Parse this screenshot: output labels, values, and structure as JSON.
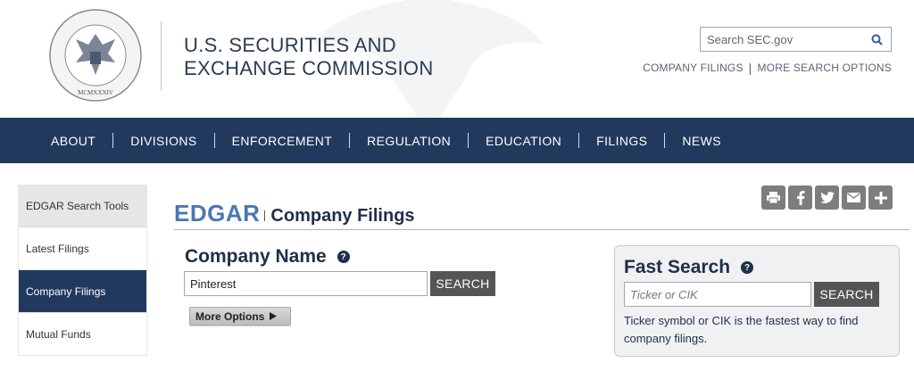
{
  "header": {
    "agency_line1": "U.S. SECURITIES AND",
    "agency_line2": "EXCHANGE COMMISSION",
    "seal_text": "U.S. SECURITIES AND EXCHANGE COMMISSION",
    "seal_year": "MCMXXXIV",
    "search_placeholder": "Search SEC.gov",
    "link_company_filings": "COMPANY FILINGS",
    "link_more_search": "MORE SEARCH OPTIONS"
  },
  "nav": {
    "items": [
      "ABOUT",
      "DIVISIONS",
      "ENFORCEMENT",
      "REGULATION",
      "EDUCATION",
      "FILINGS",
      "NEWS"
    ]
  },
  "sidebar": {
    "items": [
      {
        "label": "EDGAR Search Tools"
      },
      {
        "label": "Latest Filings"
      },
      {
        "label": "Company Filings"
      },
      {
        "label": "Mutual Funds"
      }
    ]
  },
  "main": {
    "edgar_label": "EDGAR",
    "page_title": "Company Filings",
    "company_name_heading": "Company Name",
    "company_name_value": "Pinterest",
    "search_label": "SEARCH",
    "more_options_label": "More Options"
  },
  "fast_search": {
    "heading": "Fast Search",
    "placeholder": "Ticker or CIK",
    "search_label": "SEARCH",
    "description": "Ticker symbol or CIK is the fastest way to find company filings."
  },
  "share": {
    "icons": [
      "print-icon",
      "facebook-icon",
      "twitter-icon",
      "email-icon",
      "plus-icon"
    ]
  },
  "colors": {
    "nav_bg": "#21395d",
    "edgar_blue": "#4a77b4",
    "button_gray": "#555555"
  }
}
